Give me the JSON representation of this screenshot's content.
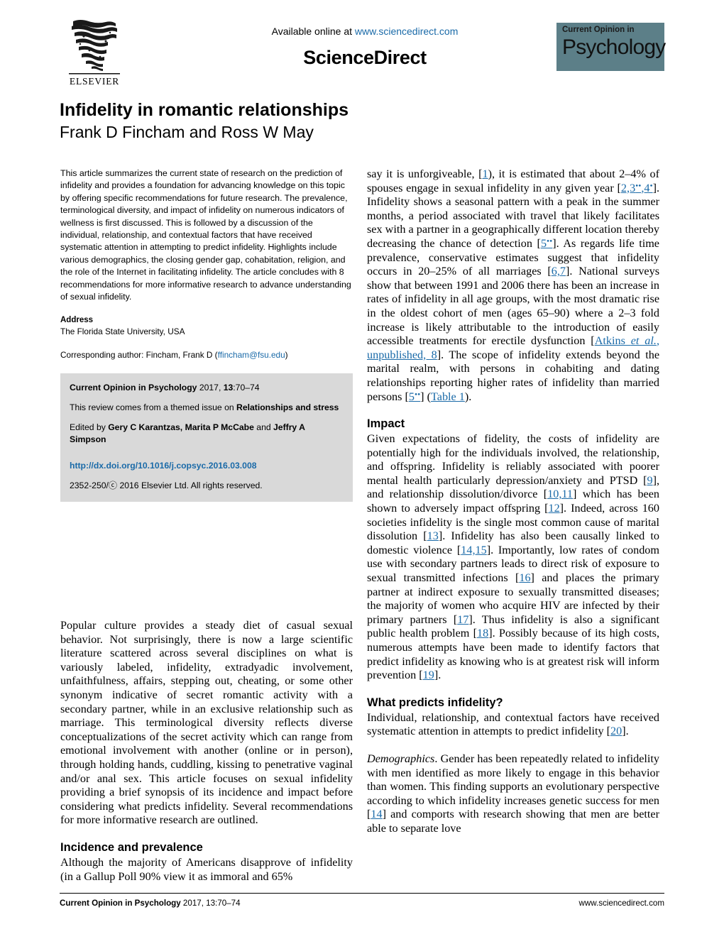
{
  "masthead": {
    "available_prefix": "Available online at ",
    "available_url": "www.sciencedirect.com",
    "sciencedirect": "ScienceDirect",
    "elsevier_wordmark": "ELSEVIER",
    "journal_badge_top": "Current Opinion in",
    "journal_badge_main": "Psychology",
    "badge_color": "#5c7f88",
    "link_color": "#1a6aa8"
  },
  "article": {
    "title": "Infidelity in romantic relationships",
    "authors": "Frank D Fincham and Ross W May"
  },
  "abstract": {
    "text": "This article summarizes the current state of research on the prediction of infidelity and provides a foundation for advancing knowledge on this topic by offering specific recommendations for future research. The prevalence, terminological diversity, and impact of infidelity on numerous indicators of wellness is first discussed. This is followed by a discussion of the individual, relationship, and contextual factors that have received systematic attention in attempting to predict infidelity. Highlights include various demographics, the closing gender gap, cohabitation, religion, and the role of the Internet in facilitating infidelity. The article concludes with 8 recommendations for more informative research to advance understanding of sexual infidelity."
  },
  "address": {
    "heading": "Address",
    "line": "The Florida State University, USA",
    "corresponding_prefix": "Corresponding author: Fincham, Frank D (",
    "corresponding_email": "ffincham@fsu.edu",
    "corresponding_suffix": ")"
  },
  "citation_box": {
    "journal_name": "Current Opinion in Psychology",
    "journal_year_vol": " 2017, ",
    "volume": "13",
    "pages": ":70–74",
    "themed_prefix": "This review comes from a themed issue on ",
    "themed_issue": "Relationships and stress",
    "edited_prefix": "Edited by ",
    "editor_1": "Gery C Karantzas, Marita P McCabe",
    "edited_and": " and ",
    "editor_2": "Jeffry A Simpson",
    "doi": "http://dx.doi.org/10.1016/j.copsyc.2016.03.008",
    "rights": "2352-250/ⓒ 2016 Elsevier Ltd. All rights reserved."
  },
  "left_column_body": {
    "intro_paragraph_part1": "Popular culture provides a steady diet of casual sexual behavior. Not surprisingly, there is now a large scientific literature scattered across several disciplines on what is variously labeled, infidelity, extradyadic involvement, unfaithfulness, affairs, stepping out, cheating, or some other synonym indicative of secret romantic activity with a secondary partner, while in an exclusive relationship such as marriage. This terminological diversity reflects diverse conceptualizations of the secret activity which can range from emotional involvement with another (online or in person), through holding hands, cuddling, kissing to penetrative vaginal and/or anal sex. This article focuses on sexual infidelity providing a brief synopsis of its incidence and impact before considering what predicts infidelity. Several recommendations for more informative research are outlined.",
    "incidence_heading": "Incidence and prevalence",
    "incidence_text": "Although the majority of Americans disapprove of infidelity (in a Gallup Poll 90% view it as immoral and 65%"
  },
  "right_column_body": {
    "continuation_1": "say it is unforgiveable, ",
    "ref_1": "1",
    "continuation_2": "), it is estimated that about 2–4% of spouses engage in sexual infidelity in any given year [",
    "ref_2": "2,3",
    "ref_2_stars": "••",
    "ref_2b": ",4",
    "ref_2b_stars": "•",
    "continuation_3": "]. Infidelity shows a seasonal pattern with a peak in the summer months, a period associated with travel that likely facilitates sex with a partner in a geographically different location thereby decreasing the chance of detection [",
    "ref_5": "5",
    "ref_5_stars": "••",
    "continuation_4": "]. As regards life time prevalence, conservative estimates suggest that infidelity occurs in 20–25% of all marriages [",
    "ref_67": "6,7",
    "continuation_5": "]. National surveys show that between 1991 and 2006 there has been an increase in rates of infidelity in all age groups, with the most dramatic rise in the oldest cohort of men (ages 65–90) where a 2–3 fold increase is likely attributable to the introduction of easily accessible treatments for erectile dysfunction [",
    "ref_atkins_a": "Atkins ",
    "ref_atkins_italic": "et al.",
    "ref_atkins_b": ", unpublished, 8",
    "continuation_6": "]. The scope of infidelity extends beyond the marital realm, with persons in cohabiting and dating relationships reporting higher rates of infidelity than married persons [",
    "ref_5b": "5",
    "ref_5b_stars": "••",
    "continuation_7": "] (",
    "ref_table": "Table 1",
    "continuation_8": ").",
    "impact_heading": "Impact",
    "impact_a": "Given expectations of fidelity, the costs of infidelity are potentially high for the individuals involved, the relationship, and offspring. Infidelity is reliably associated with poorer mental health particularly depression/anxiety and PTSD [",
    "impact_ref_9": "9",
    "impact_b": "], and relationship dissolution/divorce [",
    "impact_ref_1011": "10,11",
    "impact_c": "] which has been shown to adversely impact offspring [",
    "impact_ref_12": "12",
    "impact_d": "]. Indeed, across 160 societies infidelity is the single most common cause of marital dissolution [",
    "impact_ref_13": "13",
    "impact_e": "]. Infidelity has also been causally linked to domestic violence [",
    "impact_ref_1415": "14,15",
    "impact_f": "]. Importantly, low rates of condom use with secondary partners leads to direct risk of exposure to sexual transmitted infections [",
    "impact_ref_16": "16",
    "impact_g": "] and places the primary partner at indirect exposure to sexually transmitted diseases; the majority of women who acquire HIV are infected by their primary partners [",
    "impact_ref_17": "17",
    "impact_h": "]. Thus infidelity is also a significant public health problem [",
    "impact_ref_18": "18",
    "impact_i": "]. Possibly because of its high costs, numerous attempts have been made to identify factors that predict infidelity as knowing who is at greatest risk will inform prevention [",
    "impact_ref_19": "19",
    "impact_j": "].",
    "predicts_heading": "What predicts infidelity?",
    "predicts_a": "Individual, relationship, and contextual factors have received systematic attention in attempts to predict infidelity [",
    "predicts_ref_20": "20",
    "predicts_b": "].",
    "demographics_runin": "Demographics",
    "demographics_a": ". Gender has been repeatedly related to infidelity with men identified as more likely to engage in this behavior than women. This finding supports an evolutionary perspective according to which infidelity increases genetic success for men [",
    "demographics_ref_14": "14",
    "demographics_b": "] and comports with research showing that men are better able to separate love"
  },
  "footer": {
    "journal": "Current Opinion in Psychology",
    "citation": " 2017, 13:70–74",
    "website": "www.sciencedirect.com"
  }
}
